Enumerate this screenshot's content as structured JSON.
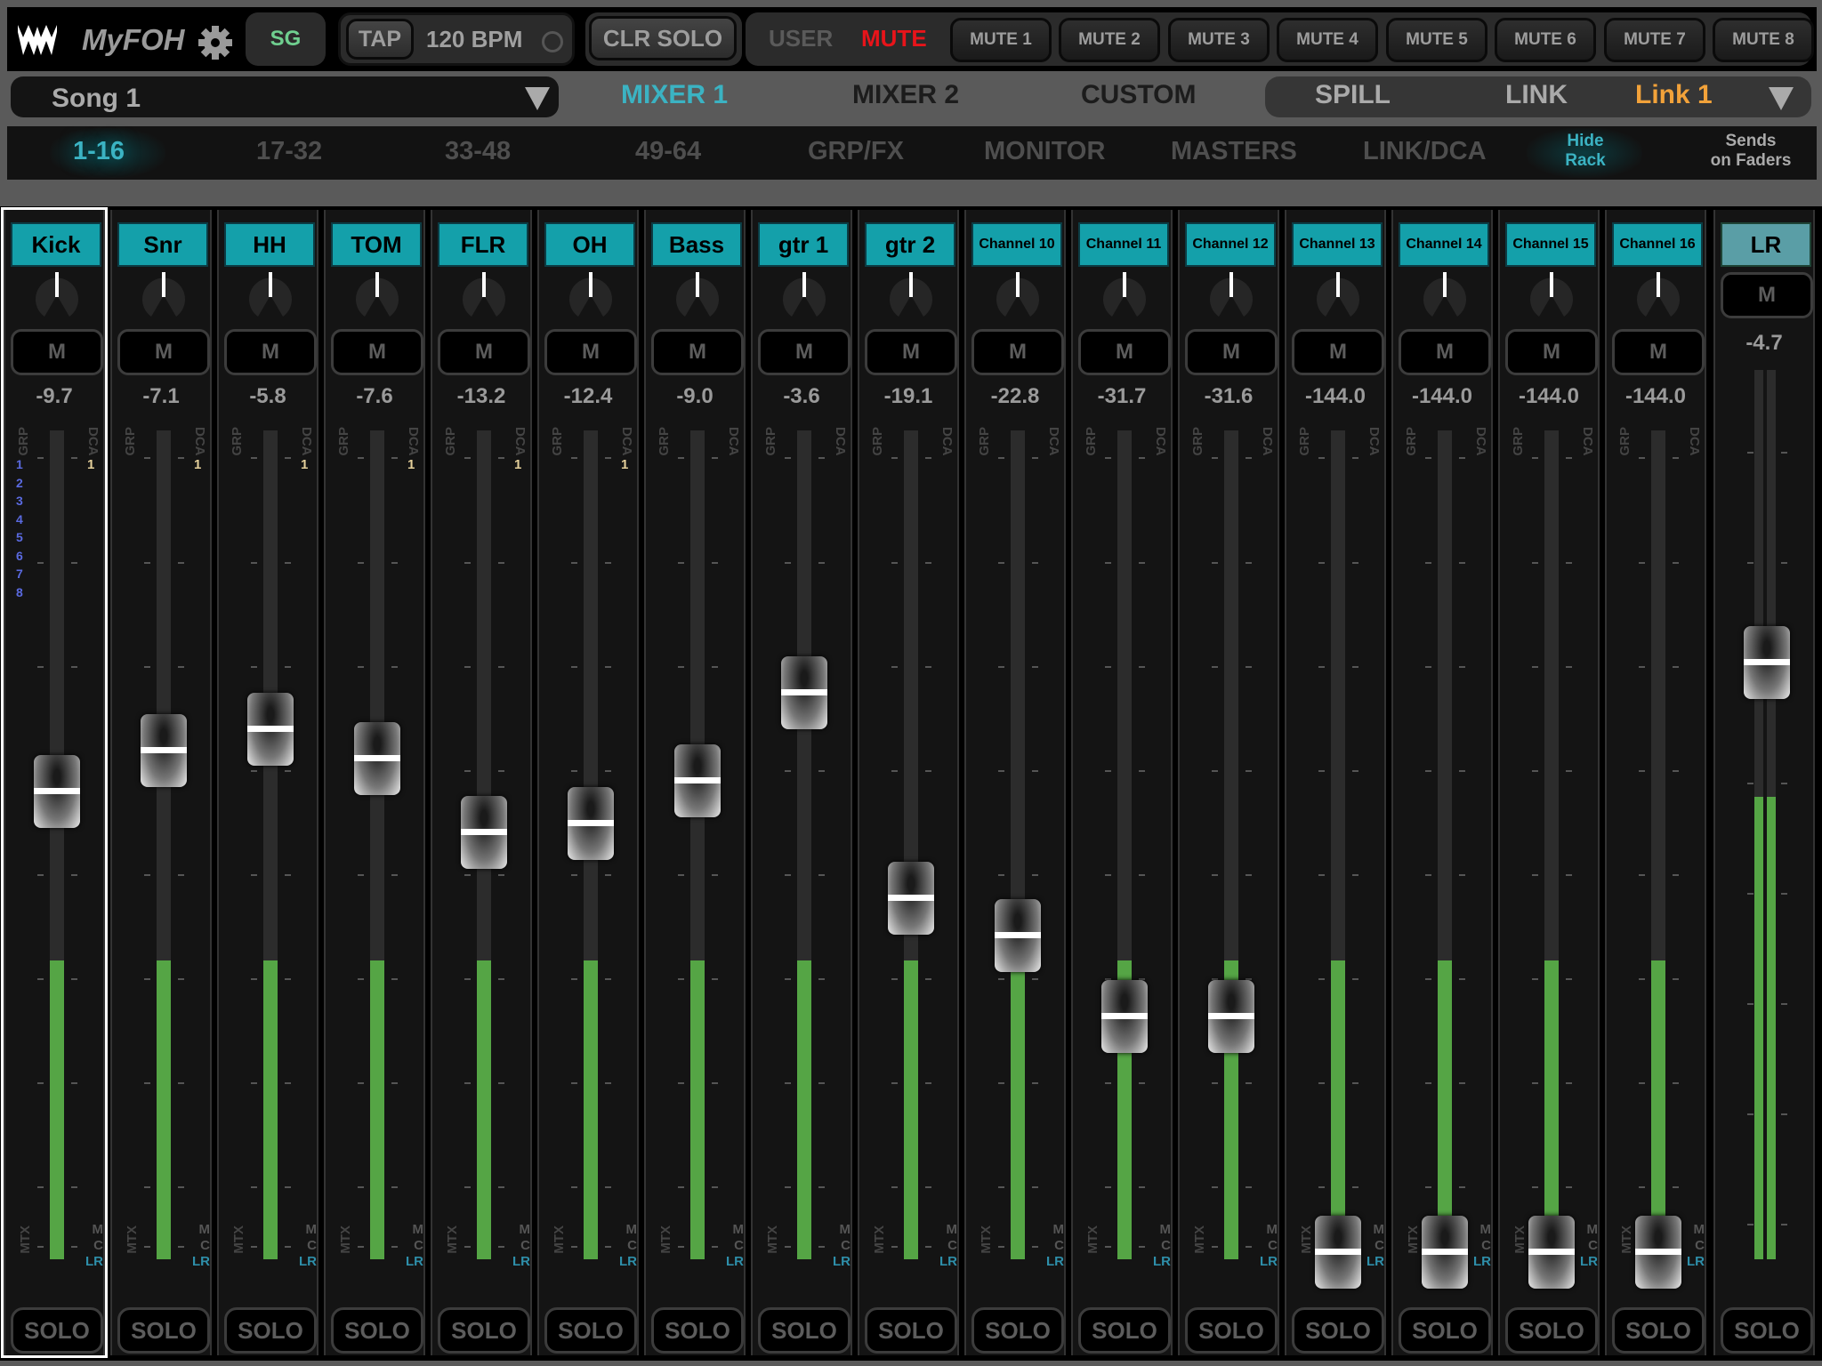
{
  "header": {
    "app_name": "MyFOH",
    "sg_label": "SG",
    "tap_label": "TAP",
    "bpm": "120 BPM",
    "clr_solo_label": "CLR SOLO",
    "user_label": "USER",
    "mute_label": "MUTE",
    "mute_groups": [
      "MUTE 1",
      "MUTE 2",
      "MUTE 3",
      "MUTE 4",
      "MUTE 5",
      "MUTE 6",
      "MUTE 7",
      "MUTE 8"
    ]
  },
  "nav": {
    "song": "Song 1",
    "tabs": [
      "MIXER 1",
      "MIXER 2",
      "CUSTOM"
    ],
    "active_tab": "MIXER 1",
    "spill_label": "SPILL",
    "link_label": "LINK",
    "link_value": "Link 1"
  },
  "banks": {
    "items": [
      "1-16",
      "17-32",
      "33-48",
      "49-64",
      "GRP/FX",
      "MONITOR",
      "MASTERS",
      "LINK/DCA"
    ],
    "active": "1-16",
    "hide_rack": [
      "Hide",
      "Rack"
    ],
    "sends_on_faders": [
      "Sends",
      "on Faders"
    ]
  },
  "strip_labels": {
    "mute": "M",
    "solo": "SOLO",
    "grp": "GRP",
    "dca": "DCA",
    "mtx": "MTX",
    "m": "M",
    "c": "C",
    "lr": "LR"
  },
  "channels": [
    {
      "name": "Kick",
      "gain_db": "-9.7",
      "fader_db": -9.7,
      "meter_level": 0.36,
      "dca": "1",
      "grp": [
        "1",
        "2",
        "3",
        "4",
        "5",
        "6",
        "7",
        "8"
      ],
      "selected": true
    },
    {
      "name": "Snr",
      "gain_db": "-7.1",
      "fader_db": -7.1,
      "meter_level": 0.36,
      "dca": "1"
    },
    {
      "name": "HH",
      "gain_db": "-5.8",
      "fader_db": -5.8,
      "meter_level": 0.36,
      "dca": "1"
    },
    {
      "name": "TOM",
      "gain_db": "-7.6",
      "fader_db": -7.6,
      "meter_level": 0.36,
      "dca": "1"
    },
    {
      "name": "FLR",
      "gain_db": "-13.2",
      "fader_db": -13.2,
      "meter_level": 0.36,
      "dca": "1"
    },
    {
      "name": "OH",
      "gain_db": "-12.4",
      "fader_db": -12.4,
      "meter_level": 0.36,
      "dca": "1"
    },
    {
      "name": "Bass",
      "gain_db": "-9.0",
      "fader_db": -9.0,
      "meter_level": 0.36
    },
    {
      "name": "gtr 1",
      "gain_db": "-3.6",
      "fader_db": -3.6,
      "meter_level": 0.36
    },
    {
      "name": "gtr 2",
      "gain_db": "-19.1",
      "fader_db": -19.1,
      "meter_level": 0.36
    },
    {
      "name": "Channel 10",
      "gain_db": "-22.8",
      "fader_db": -22.8,
      "meter_level": 0.36
    },
    {
      "name": "Channel 11",
      "gain_db": "-31.7",
      "fader_db": -31.7,
      "meter_level": 0.36
    },
    {
      "name": "Channel 12",
      "gain_db": "-31.6",
      "fader_db": -31.6,
      "meter_level": 0.36
    },
    {
      "name": "Channel 13",
      "gain_db": "-144.0",
      "fader_db": -144.0,
      "meter_level": 0.36
    },
    {
      "name": "Channel 14",
      "gain_db": "-144.0",
      "fader_db": -144.0,
      "meter_level": 0.36
    },
    {
      "name": "Channel 15",
      "gain_db": "-144.0",
      "fader_db": -144.0,
      "meter_level": 0.36
    },
    {
      "name": "Channel 16",
      "gain_db": "-144.0",
      "fader_db": -144.0,
      "meter_level": 0.36
    }
  ],
  "master": {
    "name": "LR",
    "gain_db": "-4.7",
    "fader_db": -4.7,
    "meter_level": 0.52
  },
  "colors": {
    "accent": "#3bb3c3",
    "channel_name_bg": "#14a0aa",
    "mute_active": "#e8141a",
    "link_value": "#f2a23a",
    "meter": "#55a545",
    "grp_number": "#5a6ae0",
    "dca_number": "#e4cf9a"
  }
}
